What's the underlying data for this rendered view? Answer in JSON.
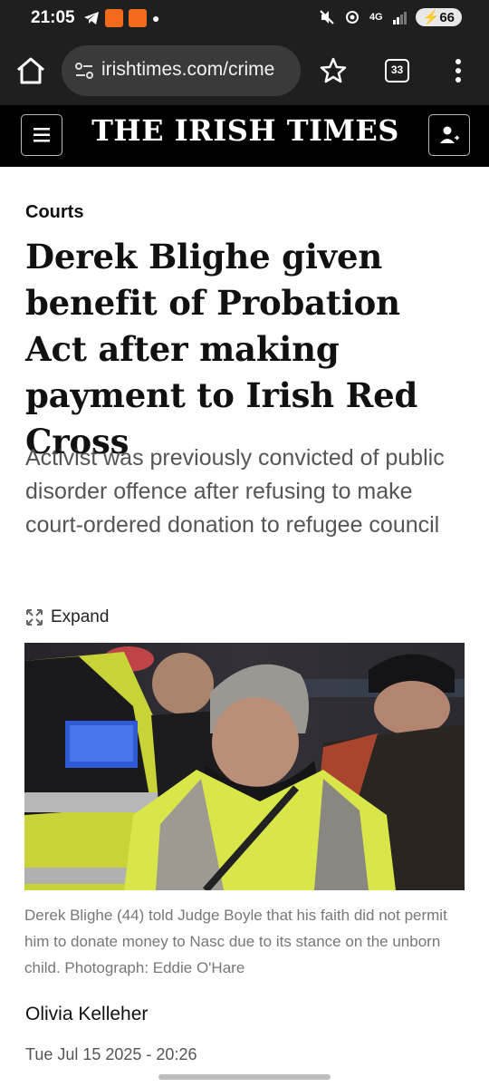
{
  "status_bar": {
    "time": "21:05",
    "network": "4G",
    "battery": "66"
  },
  "browser": {
    "url": "irishtimes.com/crime",
    "tab_count": "33"
  },
  "site": {
    "logo": "THE IRISH TIMES"
  },
  "article": {
    "section": "Courts",
    "headline": "Derek Blighe given benefit of Probation Act after making payment to Irish Red Cross",
    "standfirst": "Activist was previously convicted of public disorder offence after refusing to make court-ordered donation to refugee council",
    "expand_label": "Expand",
    "caption": "Derek Blighe (44) told Judge Boyle that his faith did not permit him to donate money to Nasc due to its stance on the unborn child. Photograph: Eddie O'Hare",
    "author": "Olivia Kelleher",
    "date": "Tue Jul 15 2025 - 20:26"
  },
  "icons": {
    "home": "home-icon",
    "site_settings": "site-settings-icon",
    "bookmark": "star-icon",
    "menu": "more-vert-icon",
    "site_menu": "hamburger-icon",
    "account": "user-icon",
    "expand": "expand-icon"
  },
  "colors": {
    "status_bg": "#1f1f1f",
    "url_bg": "#3a3a3a",
    "site_header_bg": "#000000",
    "temu_orange": "#f26b1d",
    "hi_vis": "#d6e23a"
  }
}
